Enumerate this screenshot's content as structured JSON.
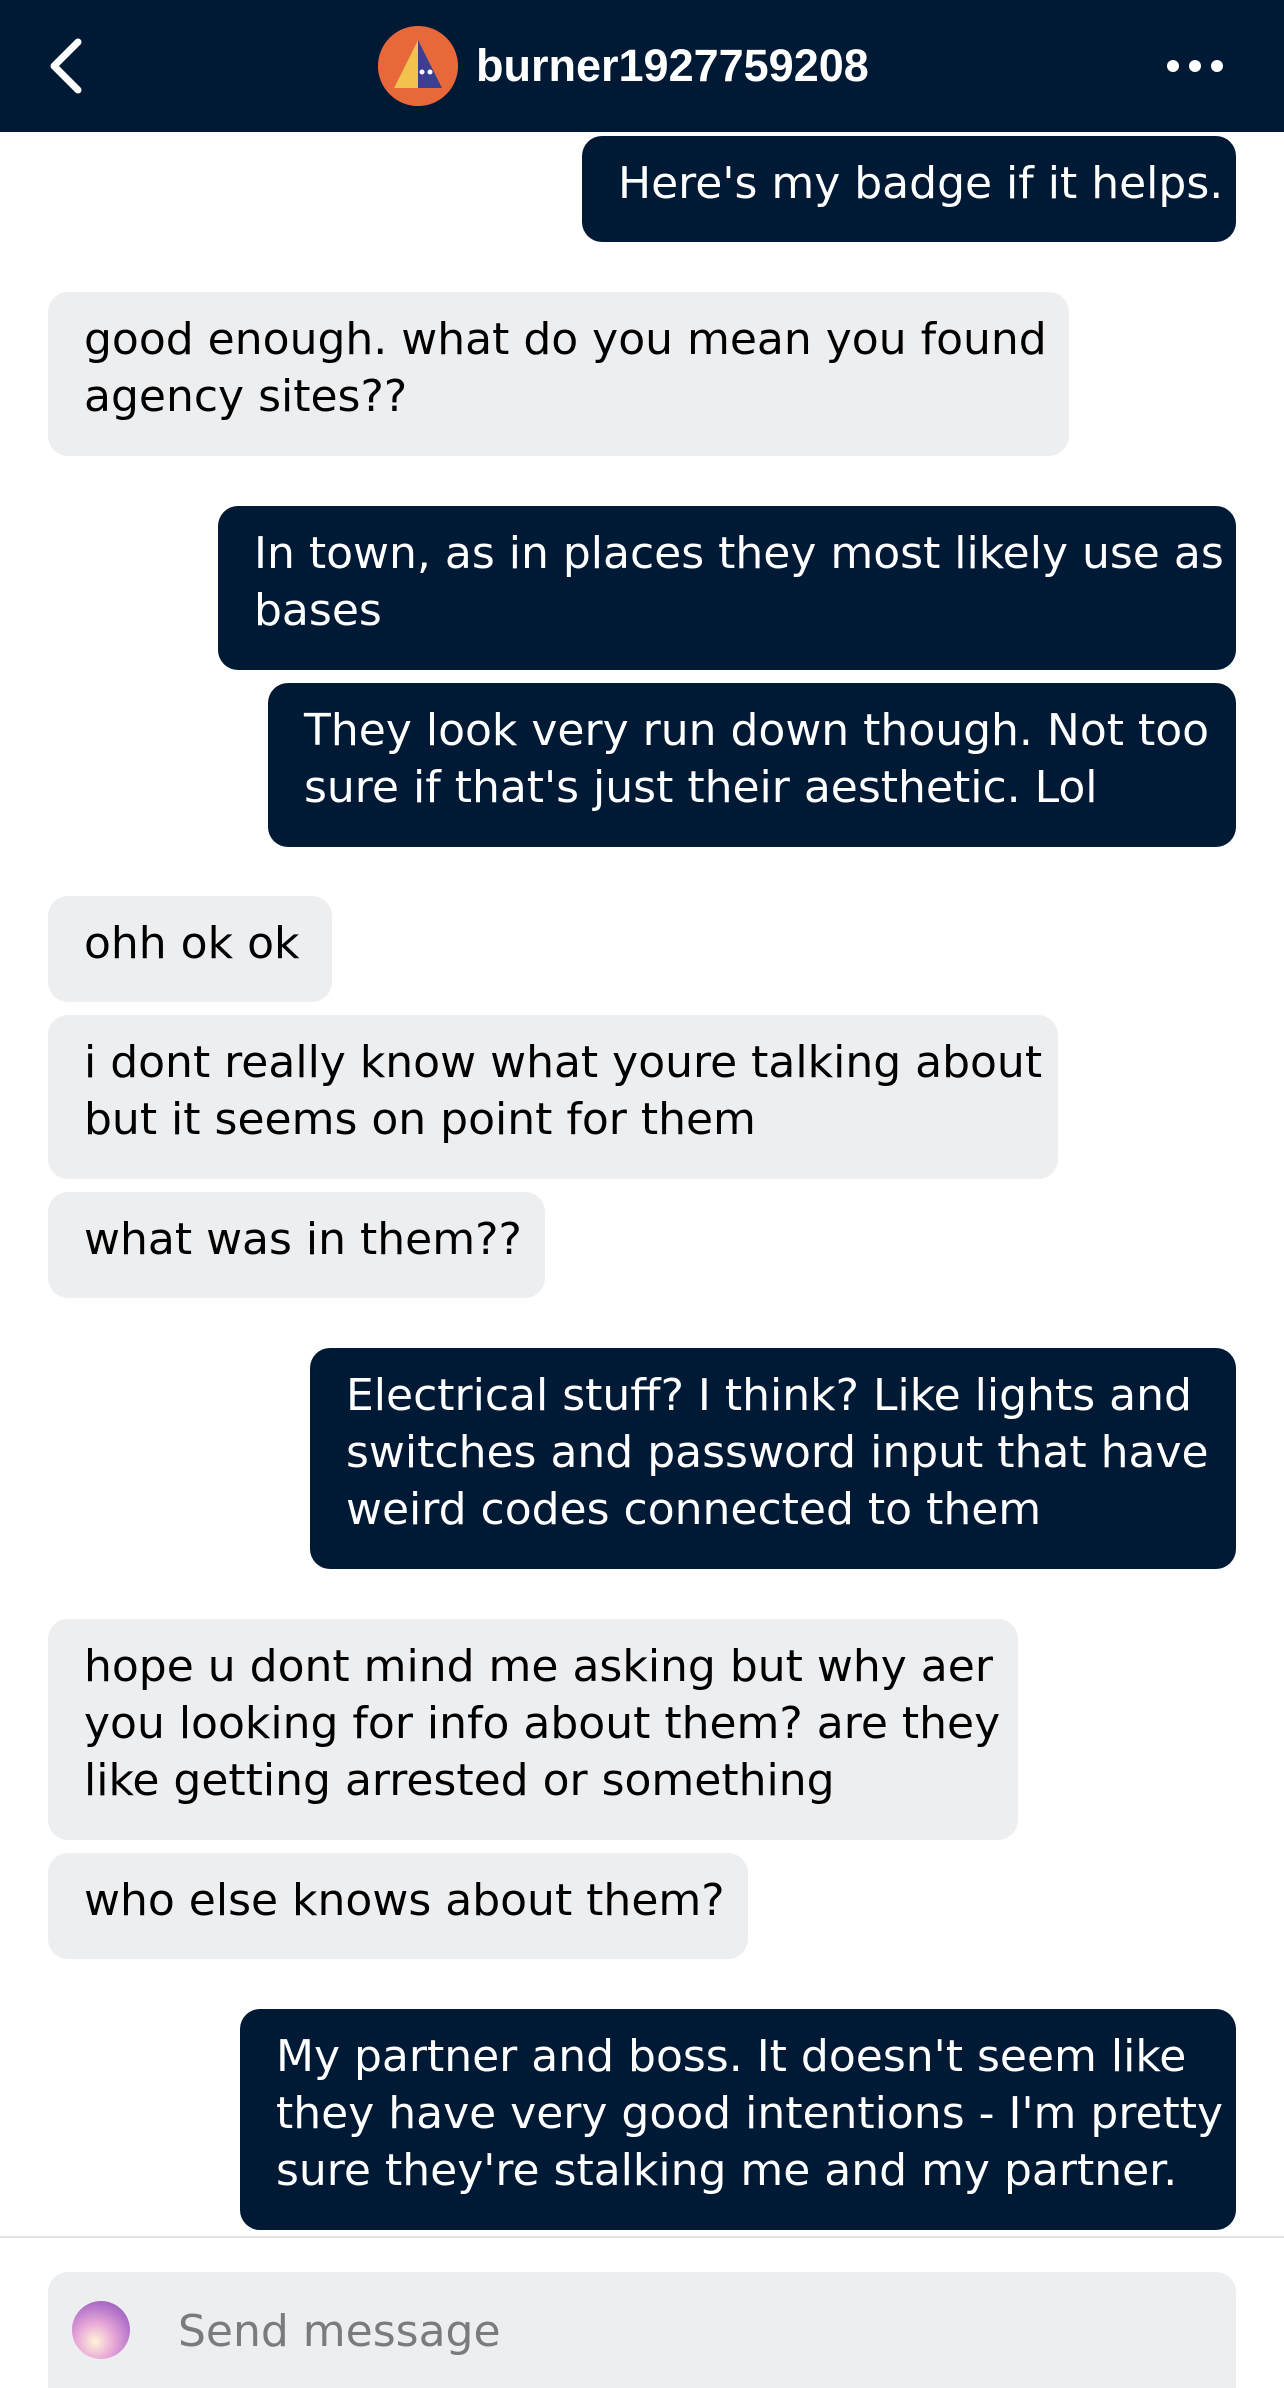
{
  "header": {
    "back_icon": "chevron-left-icon",
    "username": "burner1927759208",
    "more_icon": "more-dots-icon",
    "colors": {
      "background": "#001935",
      "avatar_background": "#e8683a"
    }
  },
  "messages": [
    {
      "direction": "sent",
      "lines": [
        "Here's my badge if it helps."
      ]
    },
    {
      "direction": "received",
      "lines": [
        "good enough. what do you mean you found",
        "agency sites??"
      ]
    },
    {
      "direction": "sent",
      "lines": [
        "In town, as in places they most likely use as",
        "bases"
      ]
    },
    {
      "direction": "sent",
      "lines": [
        "They look very run down though. Not too",
        "sure if that's just their aesthetic. Lol"
      ]
    },
    {
      "direction": "received",
      "lines": [
        "ohh ok ok"
      ]
    },
    {
      "direction": "received",
      "lines": [
        "i dont really know what youre talking about",
        "but it seems on point for them"
      ]
    },
    {
      "direction": "received",
      "lines": [
        "what was in them??"
      ]
    },
    {
      "direction": "sent",
      "lines": [
        "Electrical stuff? I think? Like lights and",
        "switches and password input that have",
        "weird codes connected to them"
      ]
    },
    {
      "direction": "received",
      "lines": [
        "hope u dont mind me asking but why aer",
        "you looking for info about them? are they",
        "like getting arrested or something"
      ]
    },
    {
      "direction": "received",
      "lines": [
        "who else knows about them?"
      ]
    },
    {
      "direction": "sent",
      "lines": [
        "My partner and boss. It doesn't seem like",
        "they have very good intentions - I'm pretty",
        "sure they're stalking me and my partner."
      ]
    }
  ],
  "composer": {
    "placeholder": "Send message",
    "value": ""
  },
  "colors": {
    "sent_bubble": "#001935",
    "received_bubble": "#edeef0"
  }
}
